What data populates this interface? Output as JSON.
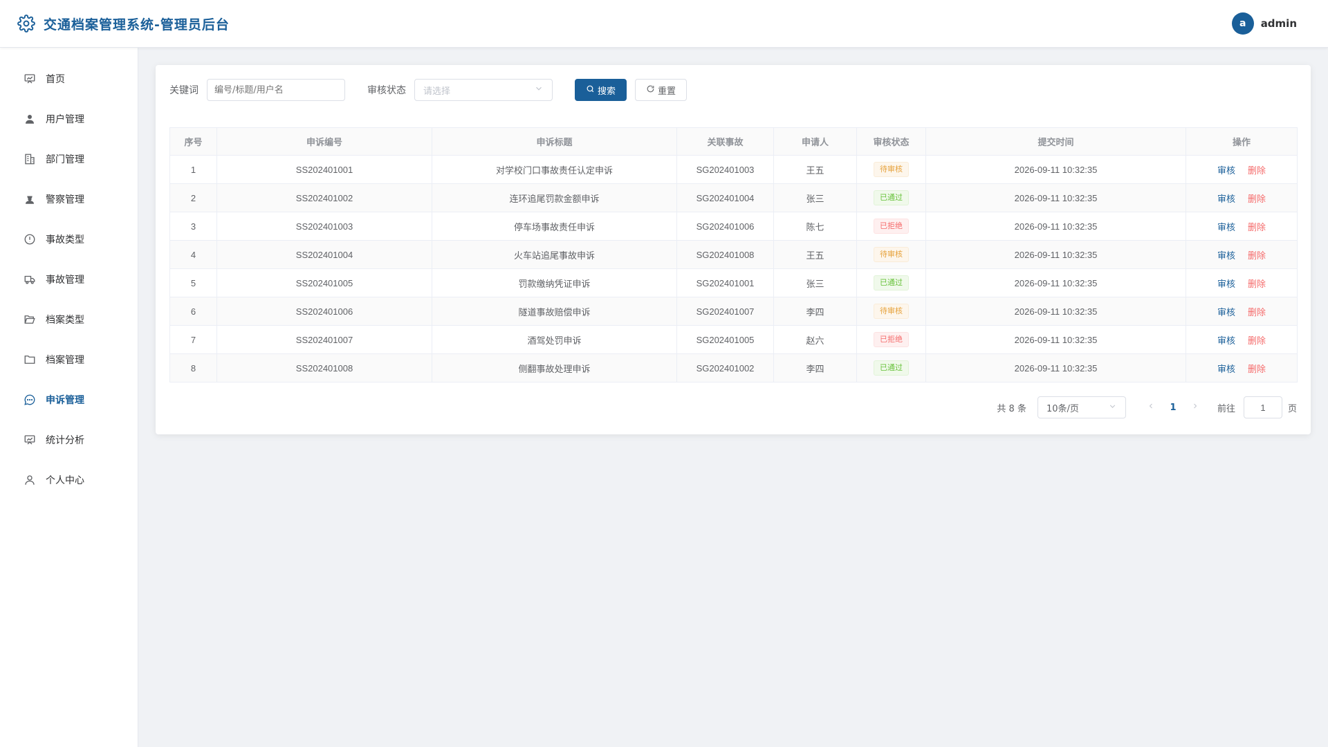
{
  "header": {
    "title": "交通档案管理系统-管理员后台",
    "user": {
      "avatar_letter": "a",
      "name": "admin"
    }
  },
  "sidebar": {
    "items": [
      {
        "label": "首页",
        "icon": "dashboard-icon"
      },
      {
        "label": "用户管理",
        "icon": "user-icon"
      },
      {
        "label": "部门管理",
        "icon": "building-icon"
      },
      {
        "label": "警察管理",
        "icon": "officer-icon"
      },
      {
        "label": "事故类型",
        "icon": "warning-circle-icon"
      },
      {
        "label": "事故管理",
        "icon": "truck-icon"
      },
      {
        "label": "档案类型",
        "icon": "folder-open-icon"
      },
      {
        "label": "档案管理",
        "icon": "folder-icon"
      },
      {
        "label": "申诉管理",
        "icon": "chat-icon",
        "active": true
      },
      {
        "label": "统计分析",
        "icon": "chart-board-icon"
      },
      {
        "label": "个人中心",
        "icon": "person-icon"
      }
    ]
  },
  "filters": {
    "keyword_label": "关键词",
    "keyword_placeholder": "编号/标题/用户名",
    "status_label": "审核状态",
    "status_placeholder": "请选择",
    "search_label": "搜索",
    "reset_label": "重置"
  },
  "table": {
    "columns": [
      "序号",
      "申诉编号",
      "申诉标题",
      "关联事故",
      "申请人",
      "审核状态",
      "提交时间",
      "操作"
    ],
    "rows": [
      {
        "index": "1",
        "code": "SS202401001",
        "title": "对学校门口事故责任认定申诉",
        "accident": "SG202401003",
        "applicant": "王五",
        "status": "待审核",
        "status_type": "warn",
        "time": "2026-09-11 10:32:35"
      },
      {
        "index": "2",
        "code": "SS202401002",
        "title": "连环追尾罚款金额申诉",
        "accident": "SG202401004",
        "applicant": "张三",
        "status": "已通过",
        "status_type": "ok",
        "time": "2026-09-11 10:32:35"
      },
      {
        "index": "3",
        "code": "SS202401003",
        "title": "停车场事故责任申诉",
        "accident": "SG202401006",
        "applicant": "陈七",
        "status": "已拒绝",
        "status_type": "no",
        "time": "2026-09-11 10:32:35"
      },
      {
        "index": "4",
        "code": "SS202401004",
        "title": "火车站追尾事故申诉",
        "accident": "SG202401008",
        "applicant": "王五",
        "status": "待审核",
        "status_type": "warn",
        "time": "2026-09-11 10:32:35"
      },
      {
        "index": "5",
        "code": "SS202401005",
        "title": "罚款缴纳凭证申诉",
        "accident": "SG202401001",
        "applicant": "张三",
        "status": "已通过",
        "status_type": "ok",
        "time": "2026-09-11 10:32:35"
      },
      {
        "index": "6",
        "code": "SS202401006",
        "title": "隧道事故赔偿申诉",
        "accident": "SG202401007",
        "applicant": "李四",
        "status": "待审核",
        "status_type": "warn",
        "time": "2026-09-11 10:32:35"
      },
      {
        "index": "7",
        "code": "SS202401007",
        "title": "酒驾处罚申诉",
        "accident": "SG202401005",
        "applicant": "赵六",
        "status": "已拒绝",
        "status_type": "no",
        "time": "2026-09-11 10:32:35"
      },
      {
        "index": "8",
        "code": "SS202401008",
        "title": "侧翻事故处理申诉",
        "accident": "SG202401002",
        "applicant": "李四",
        "status": "已通过",
        "status_type": "ok",
        "time": "2026-09-11 10:32:35"
      }
    ],
    "actions": {
      "audit": "审核",
      "delete": "删除"
    }
  },
  "pagination": {
    "total": "共 8 条",
    "page_size": "10条/页",
    "current_page": "1",
    "goto_label": "前往",
    "goto_value": "1",
    "page_suffix": "页"
  },
  "colors": {
    "primary": "#1a5f99",
    "warning": "#e6a23c",
    "success": "#67c23a",
    "danger": "#f56c6c"
  }
}
